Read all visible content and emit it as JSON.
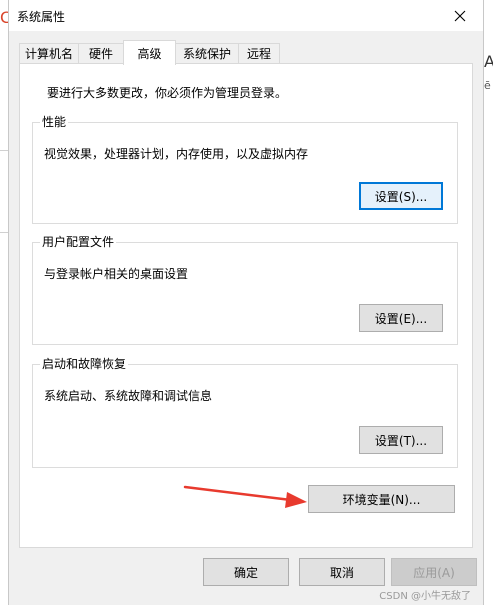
{
  "window": {
    "title": "系统属性"
  },
  "tabs": [
    {
      "label": "计算机名",
      "active": false
    },
    {
      "label": "硬件",
      "active": false
    },
    {
      "label": "高级",
      "active": true
    },
    {
      "label": "系统保护",
      "active": false
    },
    {
      "label": "远程",
      "active": false
    }
  ],
  "advanced": {
    "notice": "要进行大多数更改，你必须作为管理员登录。",
    "performance": {
      "title": "性能",
      "description": "视觉效果，处理器计划，内存使用，以及虚拟内存",
      "button": "设置(S)..."
    },
    "user_profiles": {
      "title": "用户配置文件",
      "description": "与登录帐户相关的桌面设置",
      "button": "设置(E)..."
    },
    "startup_recovery": {
      "title": "启动和故障恢复",
      "description": "系统启动、系统故障和调试信息",
      "button": "设置(T)..."
    },
    "env_button": "环境变量(N)..."
  },
  "footer": {
    "ok": "确定",
    "cancel": "取消",
    "apply": "应用(A)"
  },
  "background_fragments": {
    "left_glyph": "C",
    "right_glyph_a": "A",
    "right_glyph_b": "ē"
  },
  "watermark": "CSDN @小牛无敌了",
  "colors": {
    "focus_border": "#0078d7",
    "annotation_arrow": "#e83a2e"
  }
}
